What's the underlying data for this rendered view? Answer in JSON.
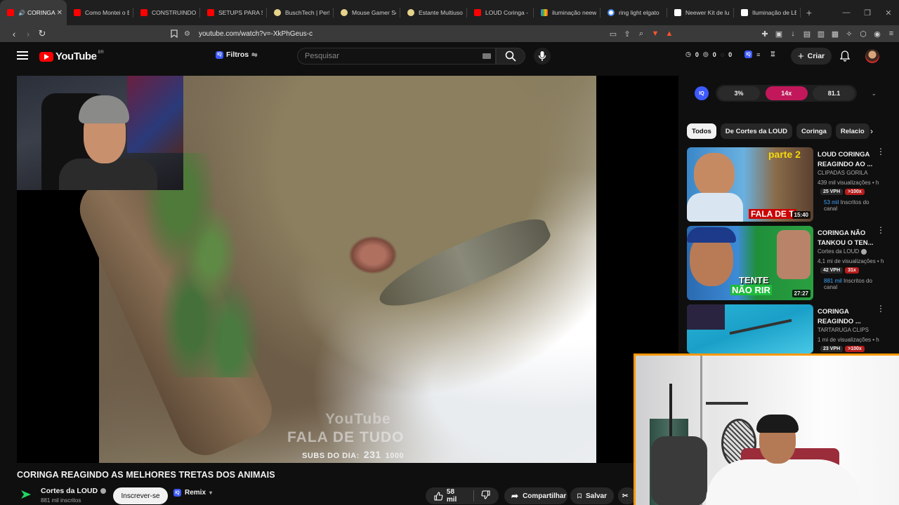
{
  "browser": {
    "tabs": [
      {
        "label": "CORINGA",
        "fav": "#ff0000",
        "active": true
      },
      {
        "label": "Como Montei o E",
        "fav": "#ff0000"
      },
      {
        "label": "CONSTRUINDO U",
        "fav": "#ff0000"
      },
      {
        "label": "SETUPS PARA SE",
        "fav": "#ff0000"
      },
      {
        "label": "BuschTech | Perfi",
        "fav": "#e6d38a"
      },
      {
        "label": "Mouse Gamer Se",
        "fav": "#e6d38a"
      },
      {
        "label": "Estante Multiuso",
        "fav": "#e6d38a"
      },
      {
        "label": "LOUD Coringa - Y",
        "fav": "#ff0000"
      },
      {
        "label": "iluminação neew",
        "fav": "#4285f4"
      },
      {
        "label": "ring light elgato",
        "fav": "#ffffff"
      },
      {
        "label": "Neewer Kit de lu",
        "fav": "#ffffff"
      },
      {
        "label": "Iluminação de LE",
        "fav": "#ffffff"
      }
    ],
    "url": "youtube.com/watch?v=-XkPhGeus-c"
  },
  "header": {
    "logo": "YouTube",
    "country": "BR",
    "filters_label": "Filtros",
    "search_placeholder": "Pesquisar",
    "counters": [
      "0",
      "0",
      "0"
    ],
    "create_label": "Criar"
  },
  "video": {
    "watermark_1": "YouTube",
    "watermark_2": "FALA DE TUDO",
    "watermark_3_prefix": "SUBS DO DIA:",
    "watermark_3_value": "231",
    "watermark_3_goal": "1000",
    "title": "CORINGA REAGINDO AS MELHORES TRETAS DOS ANIMAIS"
  },
  "channel": {
    "name": "Cortes da LOUD",
    "subs": "881 mil inscritos",
    "subscribe_label": "Inscrever-se",
    "remix_label": "Remix",
    "likes": "58 mil",
    "share_label": "Compartilhar",
    "save_label": "Salvar"
  },
  "iq": {
    "badge": "IQ",
    "pill1": "3%",
    "pill2": "14x",
    "pill3": "81.1"
  },
  "chips": [
    "Todos",
    "De Cortes da LOUD",
    "Coringa",
    "Relacio"
  ],
  "related": [
    {
      "title": "LOUD CORINGA REAGINDO AO ...",
      "channel": "CLIPADAS GORILA",
      "views": "439 mil visualizações • h",
      "vph": "25 VPH",
      "mult": ">100x",
      "subs_value": "53 mil",
      "subs_label": "Inscritos do canal",
      "duration": "15:40",
      "thumb_text": "FALA DE T",
      "thumb_badge": "parte 2"
    },
    {
      "title": "CORINGA NÃO TANKOU O TEN...",
      "channel": "Cortes da LOUD",
      "views": "4,1 mi de visualizações • h",
      "vph": "42 VPH",
      "mult": "31x",
      "subs_value": "881 mil",
      "subs_label": "Inscritos do canal",
      "duration": "27:27",
      "thumb_text_1": "TENTE",
      "thumb_text_2": "NÃO RIR"
    },
    {
      "title": "CORINGA REAGINDO ...",
      "channel": "TARTARUGA CLIPS",
      "views": "1 mi de visualizações • h",
      "vph": "23 VPH",
      "mult": ">100x"
    }
  ]
}
